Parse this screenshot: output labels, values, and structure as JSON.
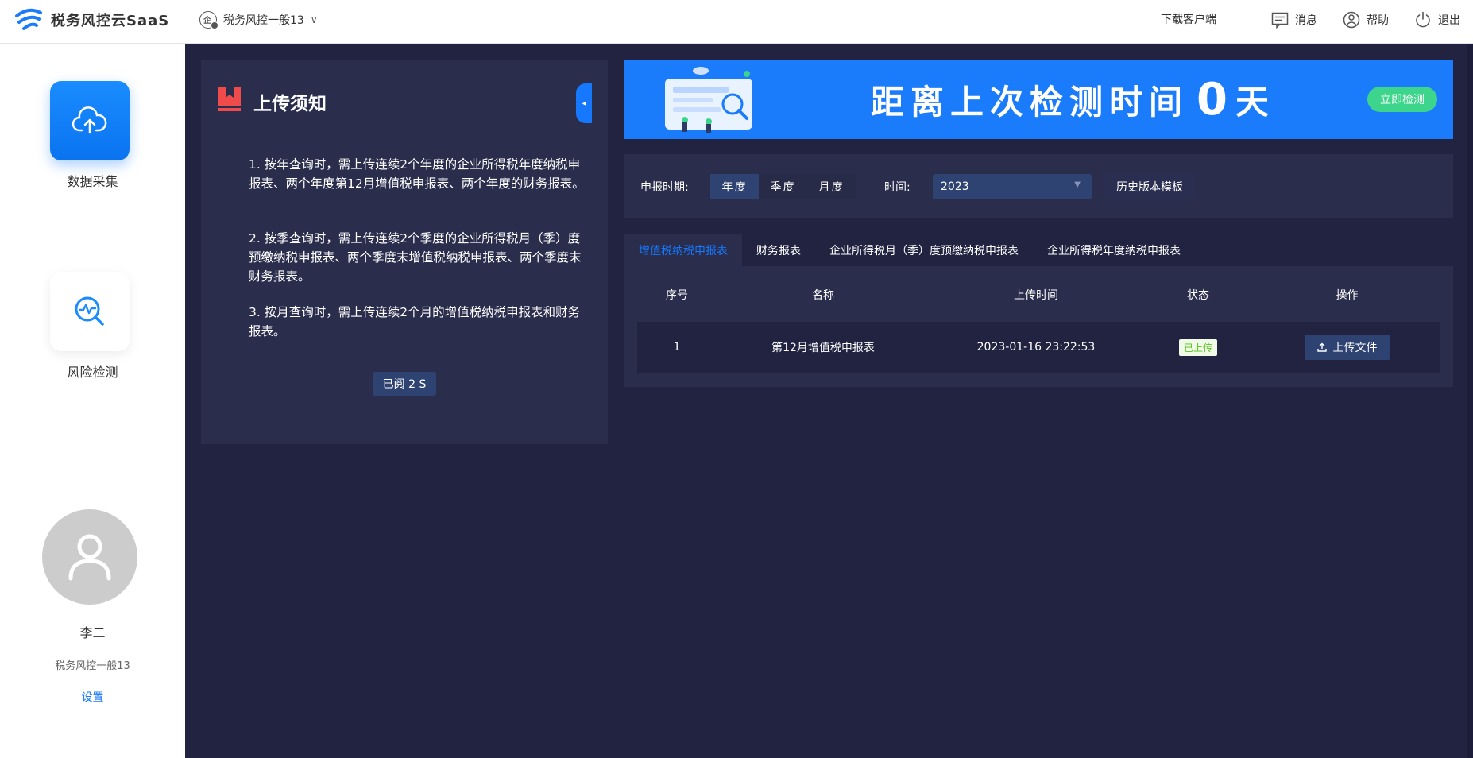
{
  "header": {
    "brand": "税务风控云SaaS",
    "org": "税务风控一般13",
    "download": "下载客户端",
    "messages": "消息",
    "help": "帮助",
    "logout": "退出"
  },
  "sidebar": {
    "items": [
      {
        "label": "数据采集",
        "icon": "cloud-upload-icon"
      },
      {
        "label": "风险检测",
        "icon": "risk-search-icon"
      }
    ],
    "user": {
      "name": "李二",
      "org": "税务风控一般13",
      "settings": "设置"
    }
  },
  "notice": {
    "title": "上传须知",
    "items": [
      "1. 按年查询时，需上传连续2个年度的企业所得税年度纳税申报表、两个年度第12月增值税申报表、两个年度的财务报表。",
      "2. 按季查询时，需上传连续2个季度的企业所得税月（季）度预缴纳税申报表、两个季度末增值税纳税申报表、两个季度末财务报表。",
      "3. 按月查询时，需上传连续2个月的增值税纳税申报表和财务报表。"
    ],
    "read_button": "已阅 2 S"
  },
  "banner": {
    "text_before": "距离上次检测时间",
    "days": "0",
    "text_after": "天",
    "button": "立即检测"
  },
  "filter": {
    "period_label": "申报时期:",
    "periods": [
      "年度",
      "季度",
      "月度"
    ],
    "active_period": "年度",
    "time_label": "时间:",
    "year": "2023",
    "history_button": "历史版本模板"
  },
  "tabs": [
    "增值税纳税申报表",
    "财务报表",
    "企业所得税月（季）度预缴纳税申报表",
    "企业所得税年度纳税申报表"
  ],
  "active_tab": "增值税纳税申报表",
  "table": {
    "columns": [
      "序号",
      "名称",
      "上传时间",
      "状态",
      "操作"
    ],
    "rows": [
      {
        "index": "1",
        "name": "第12月增值税申报表",
        "time": "2023-01-16 23:22:53",
        "status": "已上传",
        "action": "上传文件"
      }
    ]
  },
  "colors": {
    "accent": "#1677ff",
    "main_bg": "#212341",
    "panel_bg": "#2a2d4c",
    "button_bg": "#2f4372",
    "banner_bg": "#1a7cfa",
    "detect_button": "#3cd58b",
    "status_green": "#52c41a",
    "notice_icon": "#f04b4b"
  }
}
